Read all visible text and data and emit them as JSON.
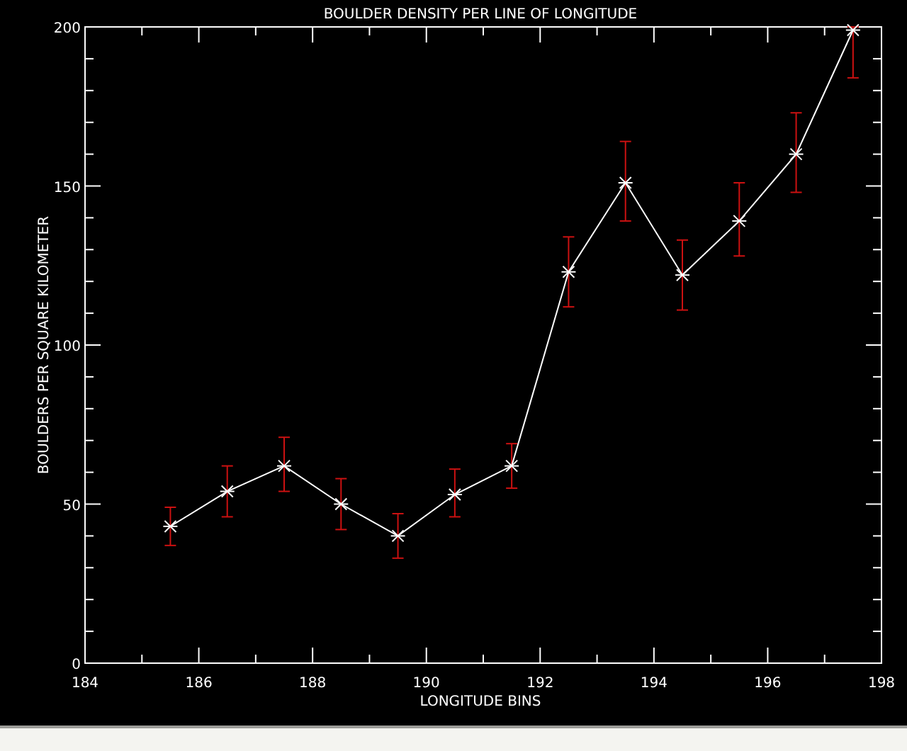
{
  "plot": {
    "chart_data": {
      "type": "line",
      "title": "BOULDER DENSITY PER LINE OF LONGITUDE",
      "xlabel": "LONGITUDE BINS",
      "ylabel": "BOULDERS PER SQUARE KILOMETER",
      "x": [
        185.5,
        186.5,
        187.5,
        188.5,
        189.5,
        190.5,
        191.5,
        192.5,
        193.5,
        194.5,
        195.5,
        196.5,
        197.5
      ],
      "series": [
        {
          "color": "#ffffff",
          "marker": "x",
          "values": [
            43,
            54,
            62,
            50,
            40,
            53,
            62,
            123,
            151,
            122,
            139,
            160,
            199
          ],
          "errors": [
            [
              37,
              49
            ],
            [
              46,
              62
            ],
            [
              54,
              71
            ],
            [
              42,
              58
            ],
            [
              33,
              47
            ],
            [
              46,
              61
            ],
            [
              55,
              69
            ],
            [
              112,
              134
            ],
            [
              139,
              164
            ],
            [
              111,
              133
            ],
            [
              128,
              151
            ],
            [
              148,
              173
            ],
            [
              184,
              200
            ]
          ]
        }
      ],
      "xlim": [
        184,
        198
      ],
      "ylim": [
        0,
        200
      ],
      "xticks": [
        184,
        186,
        188,
        190,
        192,
        194,
        196,
        198
      ],
      "yticks": [
        0,
        50,
        100,
        150,
        200
      ]
    }
  }
}
